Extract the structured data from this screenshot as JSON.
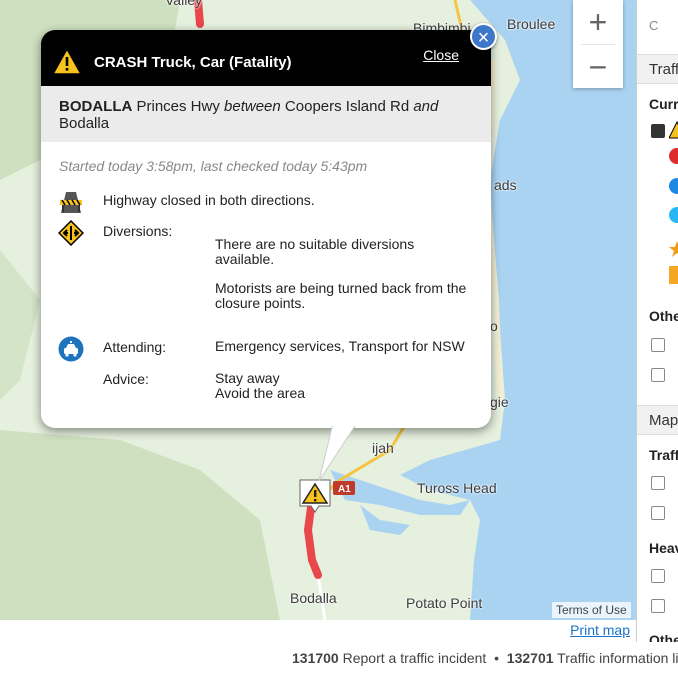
{
  "map": {
    "place_labels": [
      "Bimbimbi",
      "Broulee",
      "ads",
      "o",
      "gie",
      "ijah",
      "Tuross Head",
      "Bodalla",
      "Potato Point",
      "Valley"
    ],
    "road_shield": "A1",
    "zoom_in": "+",
    "zoom_out": "−",
    "terms": "Terms of Use",
    "print": "Print map"
  },
  "popup": {
    "title": "CRASH Truck, Car (Fatality)",
    "close": "Close",
    "suburb": "BODALLA",
    "road": "Princes Hwy",
    "between": "between",
    "from": "Coopers Island Rd",
    "and": "and",
    "to": "Bodalla",
    "started": "Started today 3:58pm, last checked today 5:43pm",
    "closure": "Highway closed in both directions.",
    "diversions_label": "Diversions:",
    "diversions_line1": "There are no suitable diversions available.",
    "diversions_line2": "Motorists are being turned back from the closure points.",
    "attending_label": "Attending:",
    "attending_value": "Emergency services, Transport for NSW",
    "advice_label": "Advice:",
    "advice_line1": "Stay away",
    "advice_line2": "Avoid the area"
  },
  "right_panel": {
    "traffic_tab": "Traffic",
    "current": "Current",
    "other": "Other",
    "map_tab": "Map",
    "traffic_sub": "Traffic",
    "heading": "Heavy",
    "other2": "Other",
    "top_partial": "C"
  },
  "footer": {
    "phone1": "131700",
    "text1": "Report a traffic incident",
    "bullet": "•",
    "phone2": "132701",
    "text2": "Traffic information line"
  },
  "colors": {
    "closure_red": "#e8474b",
    "popup_header": "#000000",
    "water": "#aad3f2",
    "land": "#e6f0de",
    "hills": "#c8dcb8",
    "accent_blue": "#3f77c8"
  }
}
